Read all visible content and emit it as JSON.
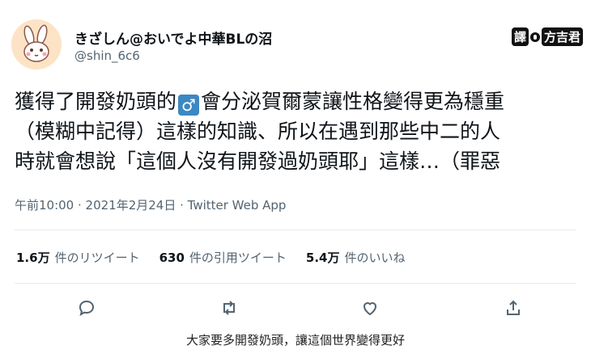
{
  "user": {
    "display_name": "きざしん@おいでよ中華BLの沼",
    "handle": "@shin_6c6",
    "avatar_icon": "rabbit-avatar-icon"
  },
  "translator_badge": {
    "prefix": "譯",
    "name": "方吉君"
  },
  "tweet": {
    "line1_before": "獲得了開發奶頭的",
    "male_sign": "♂",
    "line1_after": "會分泌賀爾蒙讓性格變得更為穩重",
    "line2": "（模糊中記得）這樣的知識、所以在遇到那些中二的人",
    "line3": "時就會想說「這個人沒有開發過奶頭耶」這樣…（罪惡"
  },
  "meta": "午前10:00 · 2021年2月24日 · Twitter Web App",
  "stats": [
    {
      "value": "1.6万",
      "label": "件のリツイート"
    },
    {
      "value": "630",
      "label": "件の引用ツイート"
    },
    {
      "value": "5.4万",
      "label": "件のいいね"
    }
  ],
  "actions": {
    "reply_icon": "reply-icon",
    "retweet_icon": "retweet-icon",
    "like_icon": "heart-icon",
    "share_icon": "share-icon"
  },
  "caption": "大家要多開發奶頭，讓這個世界變得更好",
  "colors": {
    "text": "#0f1419",
    "secondary": "#536471",
    "male_sign_bg": "#3b88c3",
    "avatar_bg": "#fde3c6"
  }
}
